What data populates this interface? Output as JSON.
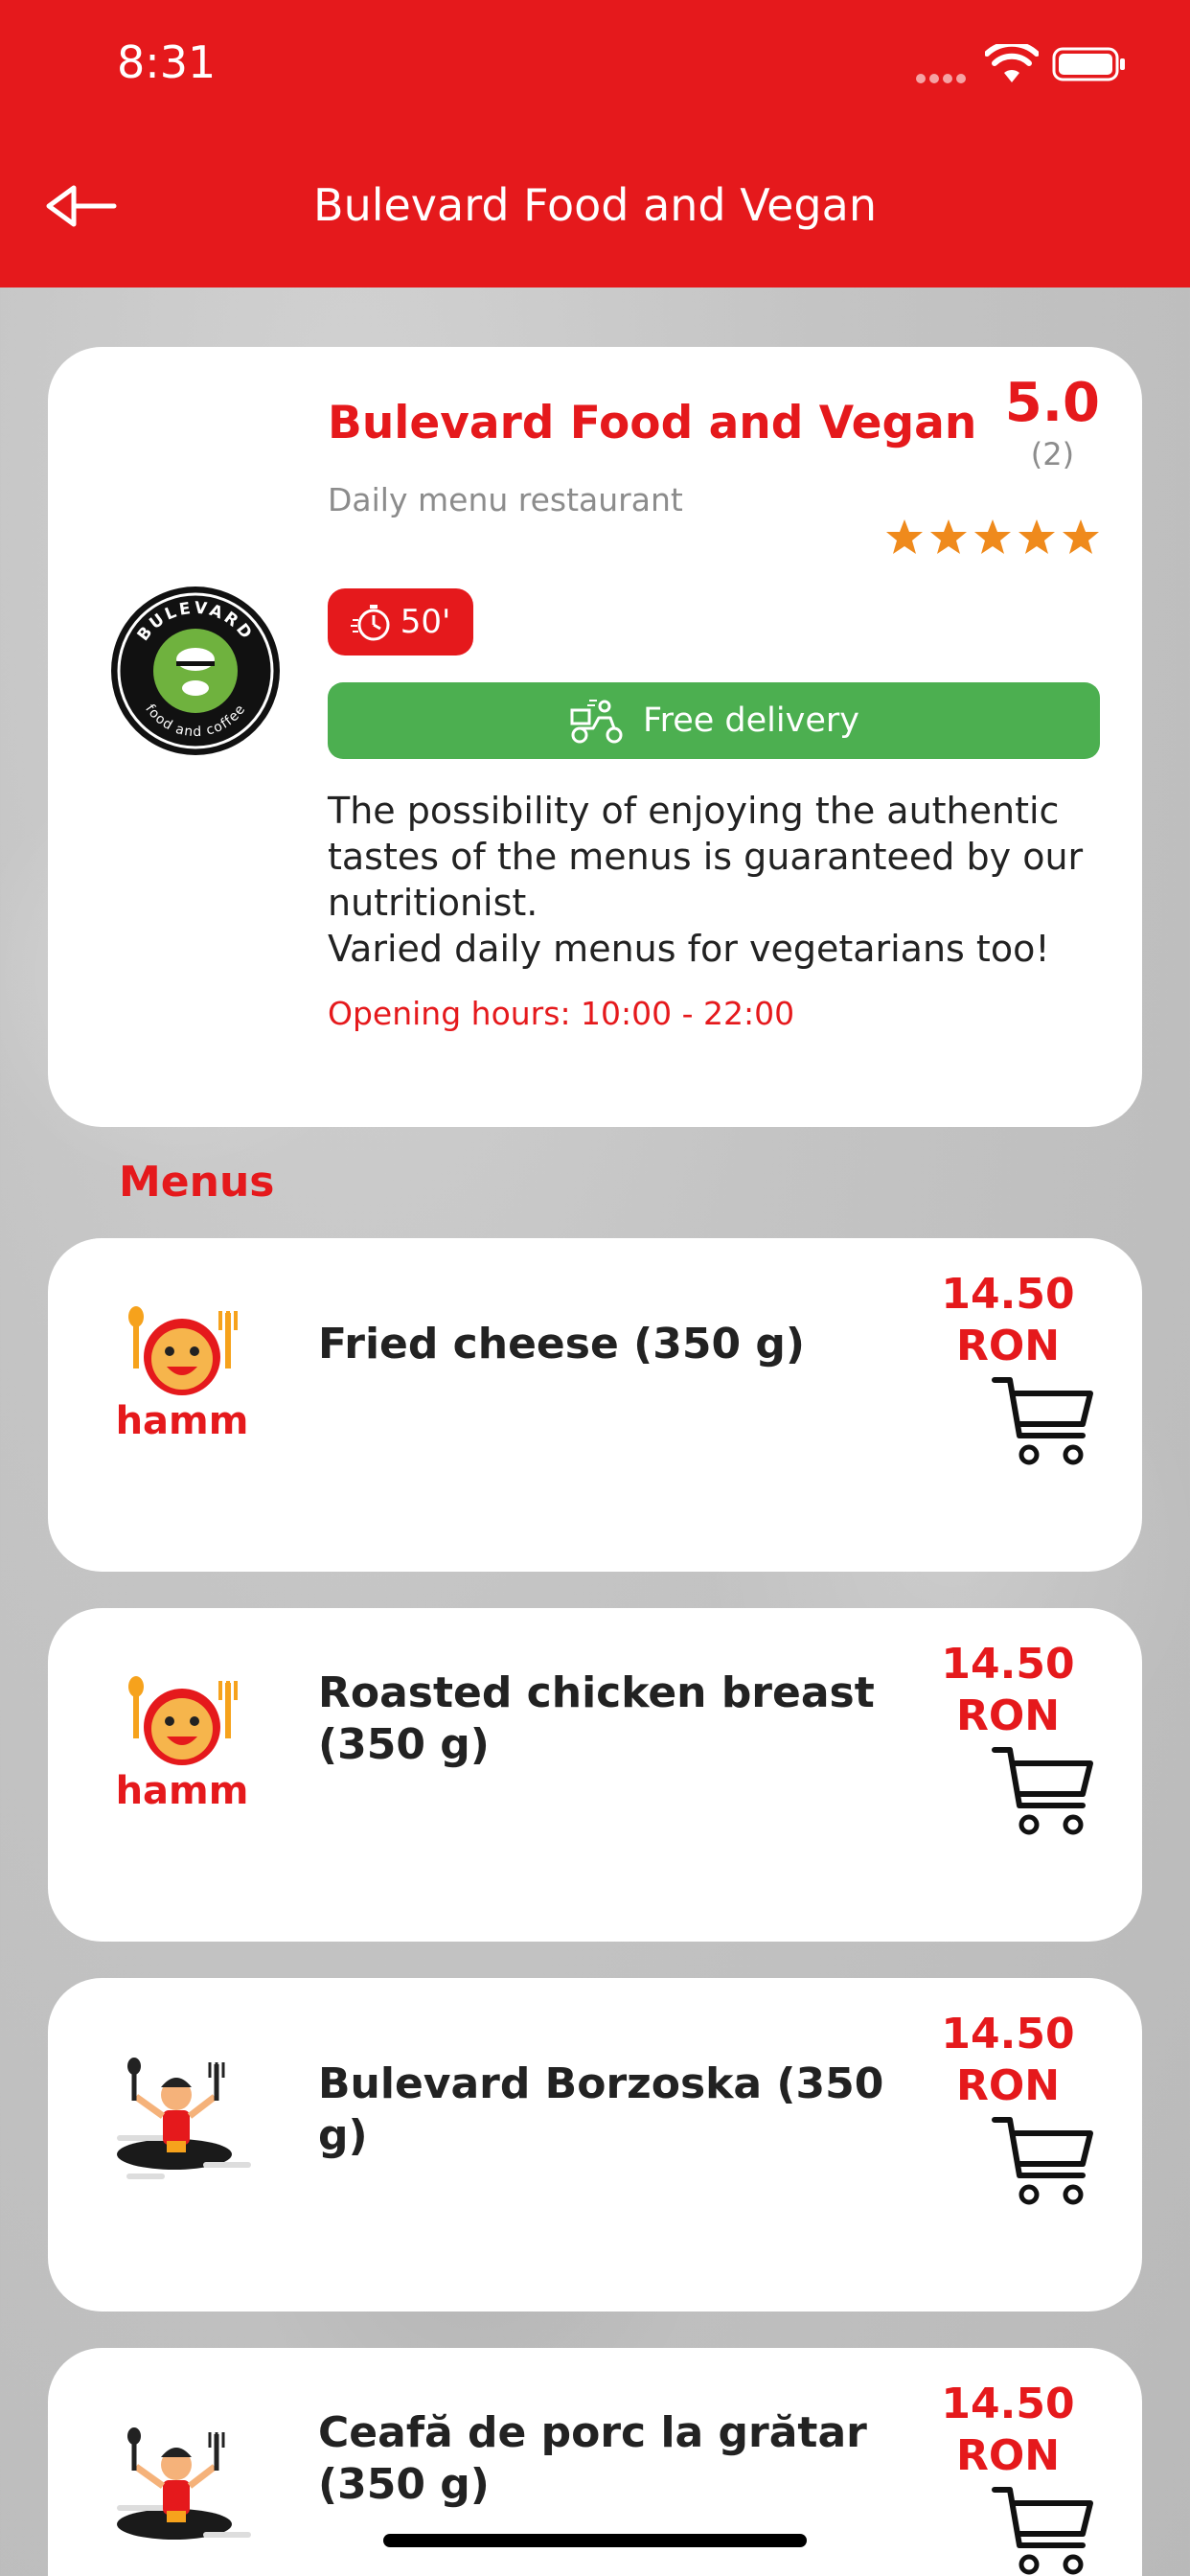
{
  "status_bar": {
    "time": "8:31"
  },
  "header": {
    "title": "Bulevard Food and Vegan"
  },
  "restaurant": {
    "name": "Bulevard Food and Vegan",
    "type": "Daily menu restaurant",
    "rating": "5.0",
    "rating_count": "(2)",
    "stars": 5,
    "delivery_time": "50'",
    "delivery_label": "Free delivery",
    "description_lines": [
      "The possibility of enjoying the authentic tastes of the menus is guaranteed by our nutritionist.",
      "Varied daily menus for vegetarians too!"
    ],
    "hours": "Opening hours: 10:00 - 22:00",
    "logo_text": {
      "top": "BULEVARD",
      "bottom": "food and coffee"
    }
  },
  "menus": {
    "title": "Menus",
    "items": [
      {
        "name": "Fried cheese (350 g)",
        "price": "14.50",
        "currency": "RON",
        "icon": "hamm-logo",
        "icon_text": "hamm"
      },
      {
        "name": "Roasted chicken breast (350 g)",
        "price": "14.50",
        "currency": "RON",
        "icon": "hamm-logo",
        "icon_text": "hamm"
      },
      {
        "name": "Bulevard Borzoska (350 g)",
        "price": "14.50",
        "currency": "RON",
        "icon": "chef-mascot"
      },
      {
        "name": "Ceafă de porc la grătar (350 g)",
        "price": "14.50",
        "currency": "RON",
        "icon": "chef-mascot"
      }
    ]
  },
  "colors": {
    "brand_red": "#e5191c",
    "delivery_green": "#4caf50",
    "star_orange": "#ef8a1c"
  }
}
